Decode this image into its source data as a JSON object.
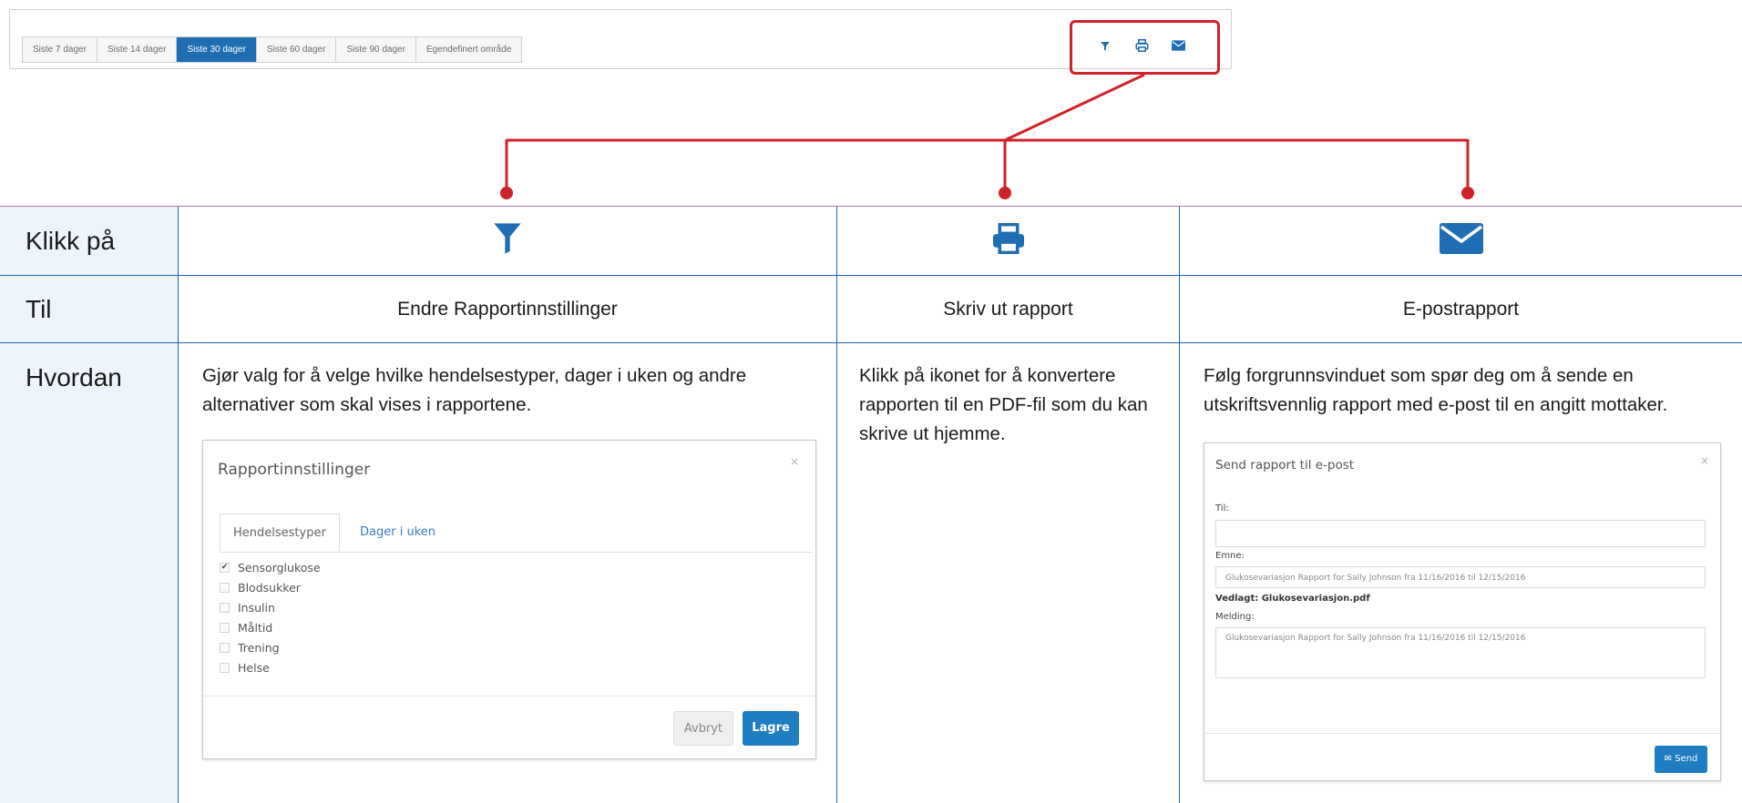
{
  "toolbar": {
    "ranges": [
      "Siste 7 dager",
      "Siste 14 dager",
      "Siste 30 dager",
      "Siste 60 dager",
      "Siste 90 dager",
      "Egendefinert område"
    ],
    "active_range": "Siste 30 dager",
    "icons": [
      "filter-icon",
      "print-icon",
      "email-icon"
    ],
    "icon_color": "#1f6db2"
  },
  "callout_color": "#d0222a",
  "table": {
    "rows": {
      "click": "Klikk på",
      "to": "Til",
      "how": "Hvordan"
    },
    "columns": [
      {
        "icon": "filter-icon",
        "to": "Endre Rapportinnstillinger",
        "how": "Gjør valg for å velge hvilke hendelsestyper, dager i uken og andre alternativer som skal vises i rapportene."
      },
      {
        "icon": "print-icon",
        "to": "Skriv ut rapport",
        "how": "Klikk på ikonet for å konvertere rapporten til en PDF-fil som du kan skrive ut hjemme."
      },
      {
        "icon": "email-icon",
        "to": "E-postrapport",
        "how": "Følg forgrunnsvinduet som spør deg om å sende en utskriftsvennlig rapport med e-post til en angitt mottaker."
      }
    ]
  },
  "settings_dialog": {
    "title": "Rapportinnstillinger",
    "close": "×",
    "tabs": [
      "Hendelsestyper",
      "Dager i uken"
    ],
    "items": [
      {
        "label": "Sensorglukose",
        "checked": "✔"
      },
      {
        "label": "Blodsukker",
        "checked": ""
      },
      {
        "label": "Insulin",
        "checked": ""
      },
      {
        "label": "Måltid",
        "checked": ""
      },
      {
        "label": "Trening",
        "checked": ""
      },
      {
        "label": "Helse",
        "checked": ""
      }
    ],
    "cancel": "Avbryt",
    "save": "Lagre"
  },
  "email_dialog": {
    "title": "Send rapport til e-post",
    "close": "×",
    "to_label": "Til:",
    "to_value": "",
    "subject_label": "Emne:",
    "subject_value": "Glukosevariasjon Rapport for Sally Johnson fra 11/16/2016 til 12/15/2016",
    "attachment": "Vedlagt: Glukosevariasjon.pdf",
    "message_label": "Melding:",
    "message_value": "Glukosevariasjon Rapport for Sally Johnson fra 11/16/2016 til 12/15/2016",
    "send": "Send"
  }
}
